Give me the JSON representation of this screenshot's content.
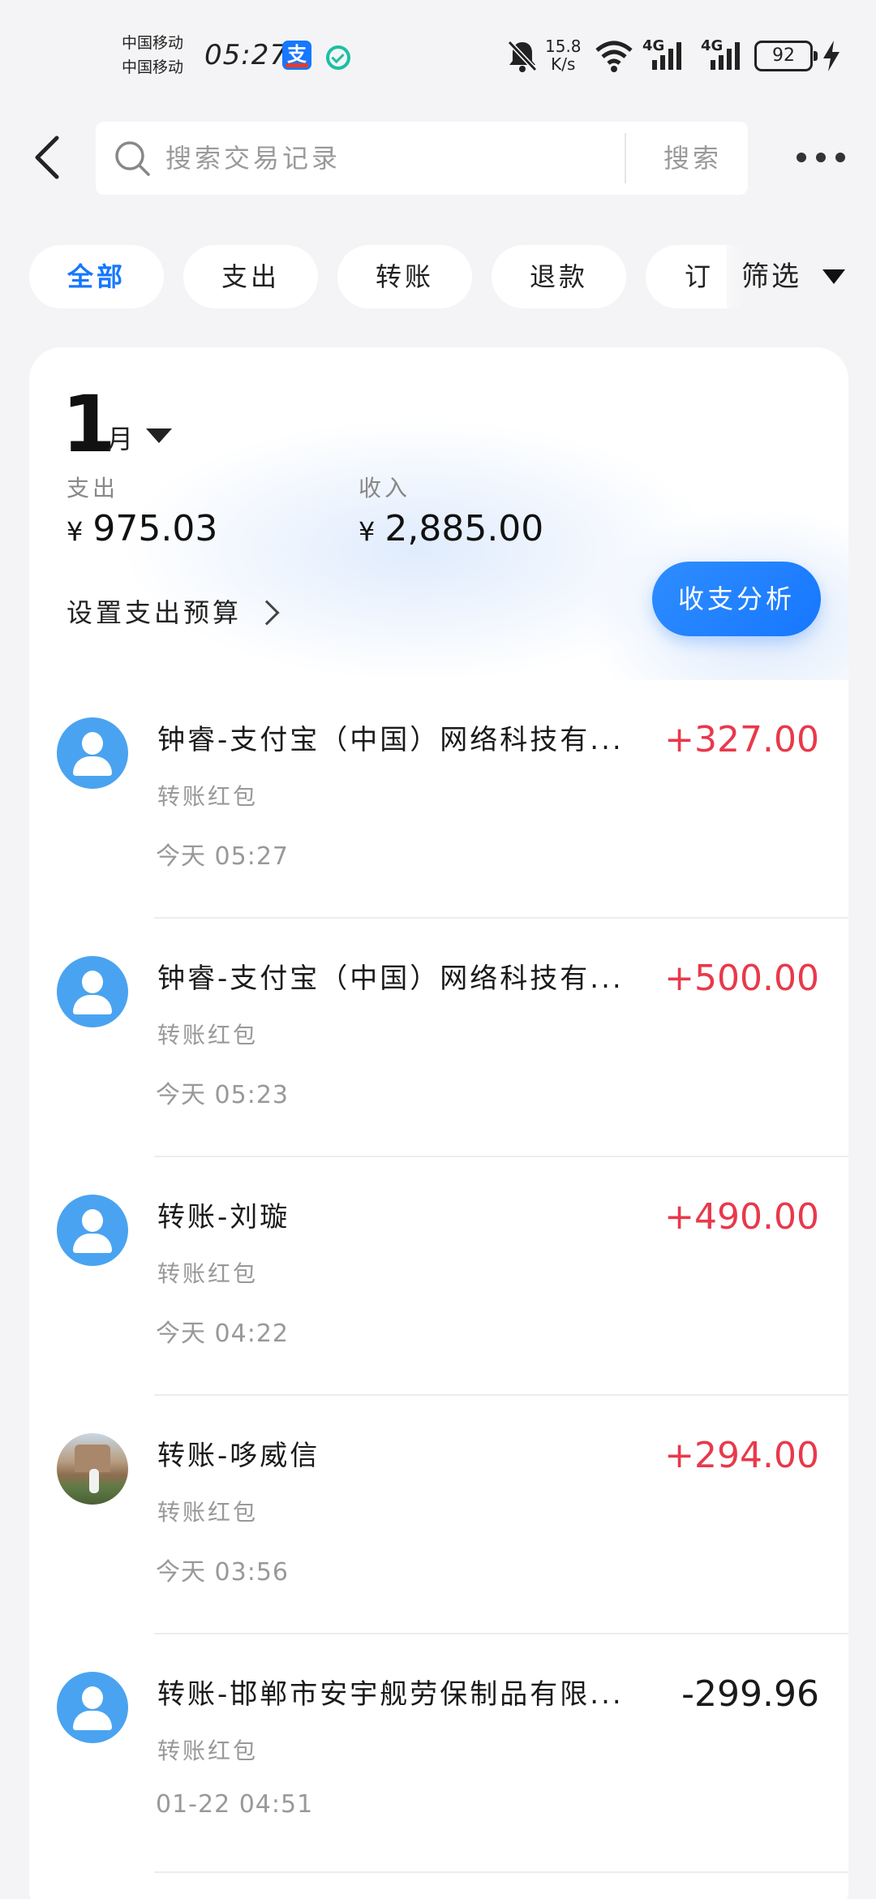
{
  "status_bar": {
    "carrier_1": "中国移动",
    "carrier_2": "中国移动",
    "time": "05:27",
    "app_icon_char": "支",
    "net_speed_value": "15.8",
    "net_speed_unit": "K/s",
    "network_1": "4G",
    "network_2": "4G",
    "battery": "92",
    "icons": [
      "alipay-icon",
      "verified-check-icon",
      "mute-bell-icon",
      "wifi-icon",
      "signal-icon",
      "signal-icon",
      "battery-icon",
      "charging-icon"
    ]
  },
  "header": {
    "search_placeholder": "搜索交易记录",
    "search_button": "搜索"
  },
  "filters": {
    "chips": [
      "全部",
      "支出",
      "转账",
      "退款",
      "订"
    ],
    "active_index": 0,
    "filter_label": "筛选"
  },
  "summary": {
    "month": "1",
    "month_unit": "月",
    "expense_label": "支出",
    "expense_currency": "¥",
    "expense_value": "975.03",
    "income_label": "收入",
    "income_currency": "¥",
    "income_value": "2,885.00",
    "budget_label": "设置支出预算",
    "analysis_button": "收支分析"
  },
  "transactions": [
    {
      "title": "钟睿-支付宝（中国）网络科技有...",
      "category": "转账红包",
      "time": "今天 05:27",
      "amount": "+327.00",
      "type": "income",
      "avatar": "default"
    },
    {
      "title": "钟睿-支付宝（中国）网络科技有...",
      "category": "转账红包",
      "time": "今天 05:23",
      "amount": "+500.00",
      "type": "income",
      "avatar": "default"
    },
    {
      "title": "转账-刘璇",
      "category": "转账红包",
      "time": "今天 04:22",
      "amount": "+490.00",
      "type": "income",
      "avatar": "default"
    },
    {
      "title": "转账-哆威信",
      "category": "转账红包",
      "time": "今天 03:56",
      "amount": "+294.00",
      "type": "income",
      "avatar": "photo"
    },
    {
      "title": "转账-邯郸市安宇舰劳保制品有限...",
      "category": "转账红包",
      "time": "01-22 04:51",
      "amount": "-299.96",
      "type": "expense",
      "avatar": "default"
    }
  ],
  "colors": {
    "accent": "#1677ff",
    "income": "#e8394b",
    "expense": "#1a1a1a",
    "background": "#f4f4f6"
  }
}
